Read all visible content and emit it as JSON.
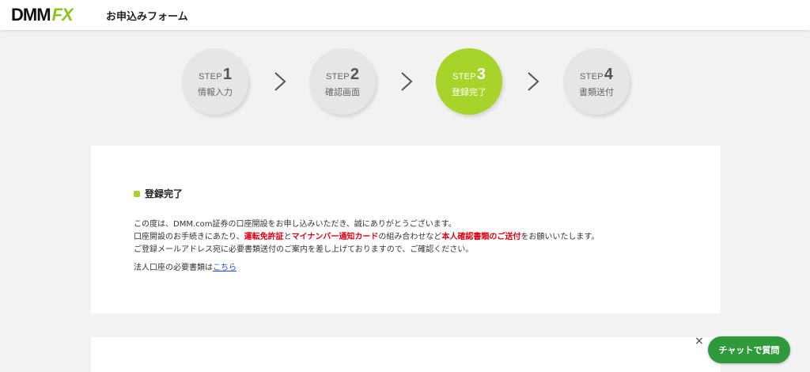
{
  "header": {
    "logo_dmm": "DMM",
    "logo_fx": "FX",
    "title": "お申込みフォーム"
  },
  "steps": [
    {
      "word": "STEP",
      "num": "1",
      "label": "情報入力",
      "active": false
    },
    {
      "word": "STEP",
      "num": "2",
      "label": "確認画面",
      "active": false
    },
    {
      "word": "STEP",
      "num": "3",
      "label": "登録完了",
      "active": true
    },
    {
      "word": "STEP",
      "num": "4",
      "label": "書類送付",
      "active": false
    }
  ],
  "section": {
    "title": "登録完了",
    "line1": "この度は、DMM.com証券の口座開設をお申し込みいただき、誠にありがとうございます。",
    "line2_a": "口座開設のお手続きにあたり、",
    "line2_b": "運転免許証",
    "line2_c": "と",
    "line2_d": "マイナンバー通知カード",
    "line2_e": "の組み合わせなど",
    "line2_f": "本人確認書類のご送付",
    "line2_g": "をお願いいたします。",
    "line3": "ご登録メールアドレス宛に必要書類送付のご案内を差し上げておりますので、ご確認ください。",
    "line4_a": "法人口座の必要書類は",
    "line4_link": "こちら"
  },
  "chat": {
    "close": "×",
    "button": "チャットで質問"
  },
  "colors": {
    "accent_green": "#a7d32b",
    "chat_green": "#2e9a3c",
    "highlight_red": "#e60012"
  }
}
